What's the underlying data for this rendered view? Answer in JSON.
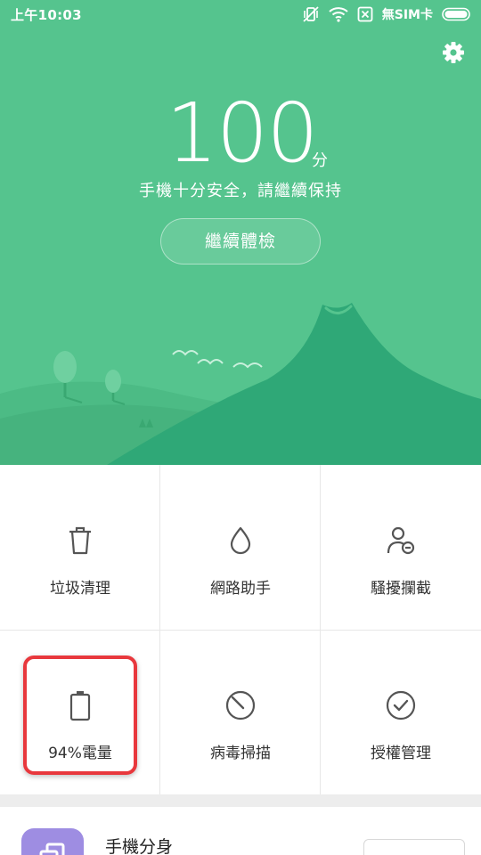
{
  "status_bar": {
    "time": "上午10:03",
    "sim_text": "無SIM卡",
    "icons": [
      "vibrate-off-icon",
      "wifi-icon",
      "no-sim-icon",
      "battery-icon"
    ]
  },
  "hero": {
    "score": "100",
    "score_unit": "分",
    "message": "手機十分安全，請繼續保持",
    "continue_button": "繼續體檢",
    "settings_icon": "gear-icon",
    "background_color": "#55c48e"
  },
  "tiles": [
    {
      "label": "垃圾清理",
      "icon": "trash-icon"
    },
    {
      "label": "網路助手",
      "icon": "drop-icon"
    },
    {
      "label": "騷擾攔截",
      "icon": "user-block-icon"
    },
    {
      "label": "94%電量",
      "icon": "battery-icon"
    },
    {
      "label": "病毒掃描",
      "icon": "scan-icon"
    },
    {
      "label": "授權管理",
      "icon": "check-circle-icon"
    }
  ],
  "highlight_color": "#e8383d",
  "bottom_item": {
    "title": "手機分身",
    "icon": "dual-app-icon",
    "icon_color": "#9e8de2"
  }
}
